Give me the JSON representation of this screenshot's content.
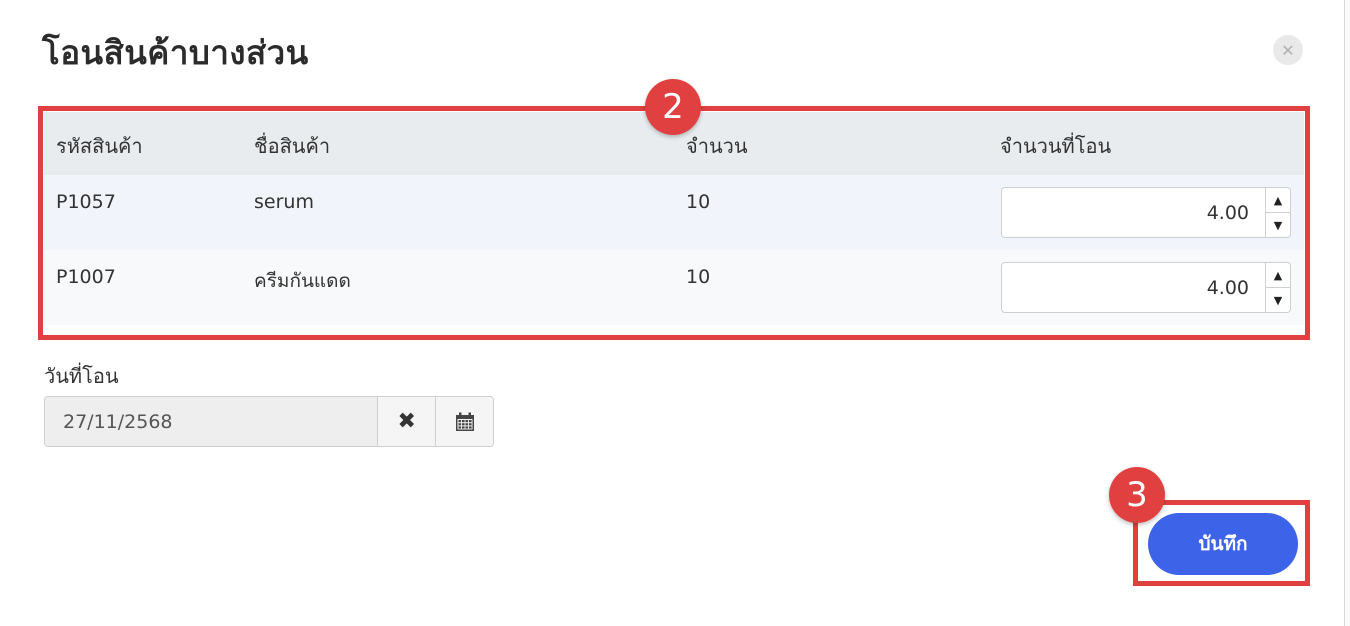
{
  "modal": {
    "title": "โอนสินค้าบางส่วน",
    "close_symbol": "✕"
  },
  "table": {
    "headers": [
      "รหัสสินค้า",
      "ชื่อสินค้า",
      "จำนวน",
      "จำนวนที่โอน"
    ],
    "rows": [
      {
        "code": "P1057",
        "name": "serum",
        "qty": "10",
        "transfer": "4.00"
      },
      {
        "code": "P1007",
        "name": "ครีมกันแดด",
        "qty": "10",
        "transfer": "4.00"
      }
    ]
  },
  "date": {
    "label": "วันที่โอน",
    "value": "27/11/2568",
    "clear_symbol": "✖"
  },
  "actions": {
    "save_label": "บันทึก"
  },
  "annotations": {
    "badge_table": "2",
    "badge_save": "3"
  },
  "colors": {
    "highlight": "#e0403f",
    "primary": "#3d63e8",
    "header_bg": "#e9ecef"
  },
  "icons": {
    "close": "close-icon",
    "clear": "x-icon",
    "calendar": "calendar-icon",
    "spin_up": "caret-up-icon",
    "spin_down": "caret-down-icon"
  }
}
